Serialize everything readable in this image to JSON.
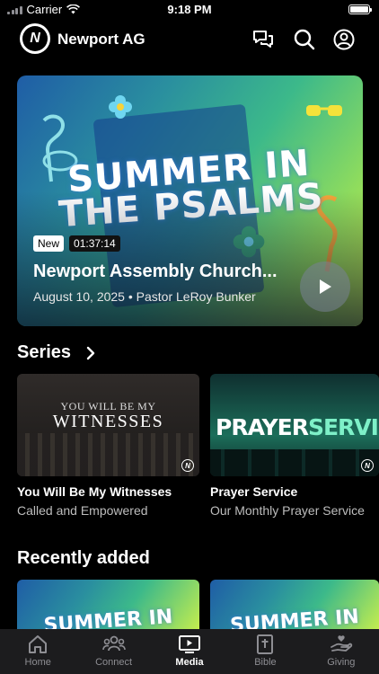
{
  "status_bar": {
    "carrier": "Carrier",
    "time": "9:18 PM"
  },
  "header": {
    "logo_letter": "N",
    "title": "Newport AG"
  },
  "hero": {
    "art_line1": "SUMMER IN",
    "art_line2": "THE PSALMS",
    "badge_new": "New",
    "duration": "01:37:14",
    "title": "Newport Assembly Church...",
    "subtitle": "August 10, 2025 • Pastor LeRoy Bunker"
  },
  "series": {
    "heading": "Series",
    "cards": [
      {
        "art_small": "YOU WILL BE MY",
        "art_big": "WITNESSES",
        "title": "You Will Be My Witnesses",
        "subtitle": "Called and Empowered"
      },
      {
        "art_a": "PRAYER",
        "art_b": "SERVICE",
        "title": "Prayer Service",
        "subtitle": "Our Monthly Prayer Service"
      }
    ]
  },
  "recent": {
    "heading": "Recently added",
    "art_text": "SUMMER IN"
  },
  "tabs": [
    {
      "label": "Home",
      "icon": "home-icon"
    },
    {
      "label": "Connect",
      "icon": "people-icon"
    },
    {
      "label": "Media",
      "icon": "media-icon"
    },
    {
      "label": "Bible",
      "icon": "bible-icon"
    },
    {
      "label": "Giving",
      "icon": "giving-icon"
    }
  ],
  "colors": {
    "background": "#000000",
    "tabbar": "#1c1c1e",
    "inactive": "#8e8e93"
  }
}
